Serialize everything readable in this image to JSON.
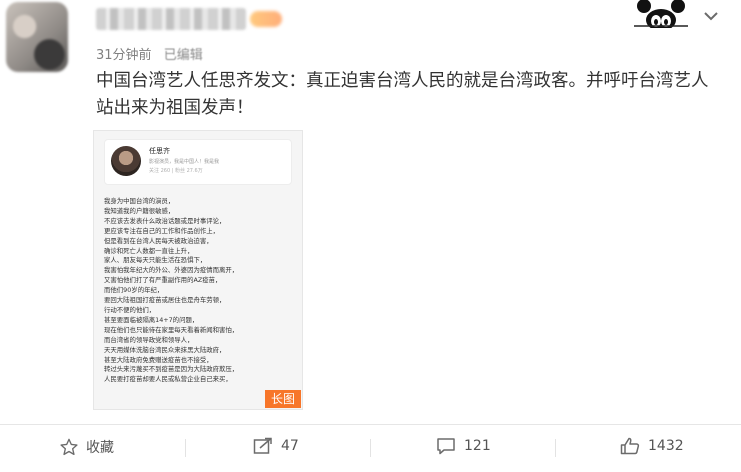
{
  "header": {
    "timestamp": "31分钟前",
    "edited_label": "已编辑"
  },
  "post": {
    "text": "中国台湾艺人任思齐发文：真正迫害台湾人民的就是台湾政客。并呼吁台湾艺人站出来为祖国发声！"
  },
  "image_card": {
    "profile_name": "任思齐",
    "profile_line1": "影视演员，我是中国人！我是我",
    "profile_line2": "关注 260 | 粉丝 27.6万",
    "lines": [
      "我身为中国台湾的演员，",
      "我知道我的户籍很敏感，",
      "不应该去发表什么政治话题或是时事评论，",
      "更应该专注在自己的工作和作品创作上，",
      "但是看到在台湾人民每天被政治迫害，",
      "确诊和死亡人数都一直往上升，",
      "家人、朋友每天只能生活在恐惧下，",
      "我害怕我年纪大的外公、外婆因为疫情而离开，",
      "又害怕他们打了有严重副作用的AZ疫苗，",
      "而他们90岁的年纪，",
      "要回大陆祖国打疫苗或居住也是舟车劳顿，",
      "行动不便的他们，",
      "甚至要面临被隔离14+7的问题，",
      "现在他们也只能待在家里每天看着新闻和害怕，",
      "而台湾省的领导政党和领导人，",
      "天天用媒体洗脑台湾民众来抹黑大陆政府，",
      "甚至大陆政府免费赠送疫苗也不接受，",
      "转过头来污蔑买不到疫苗是因为大陆政府欺压，",
      "人民要打疫苗却要人民或私营企业自己来买，"
    ],
    "long_image_tag": "长图"
  },
  "actions": {
    "favorite_label": "收藏",
    "repost_count": "47",
    "comment_count": "121",
    "like_count": "1432"
  },
  "colors": {
    "tag_bg": "#f7762a",
    "icon_gray": "#6b6b6b"
  }
}
